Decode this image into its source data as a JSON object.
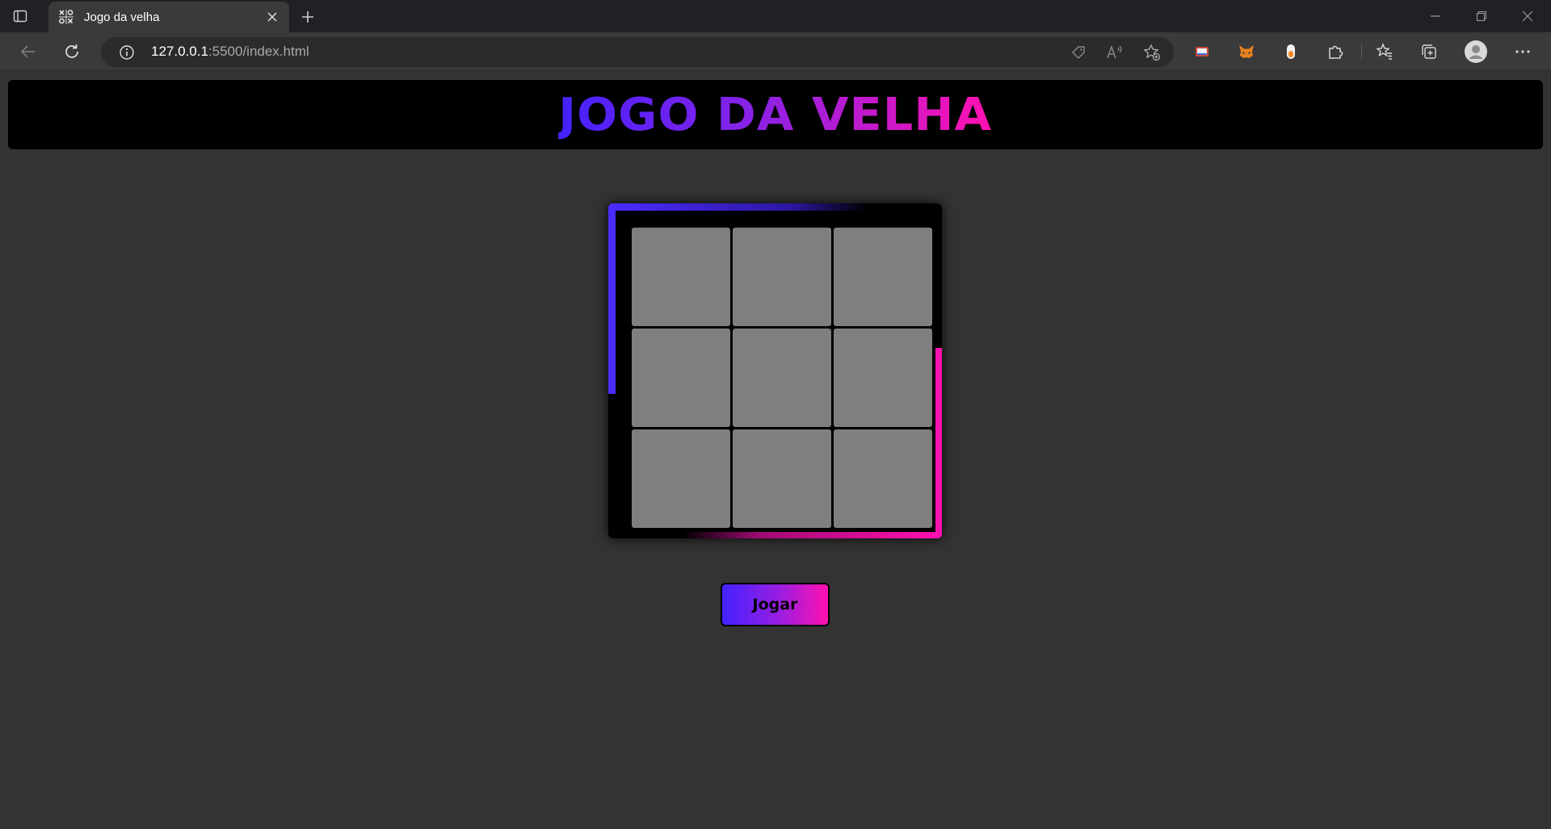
{
  "browser": {
    "tab": {
      "title": "Jogo da velha",
      "favicon": "tic-tac-toe-favicon"
    },
    "address": {
      "host": "127.0.0.1",
      "rest": ":5500/index.html"
    },
    "colors": {
      "tabstrip": "#202124",
      "toolbar": "#3a3a3a",
      "omnibox": "#2b2b2b"
    }
  },
  "page": {
    "title": "JOGO DA VELHA",
    "board": {
      "rows": 3,
      "cols": 3,
      "cells": [
        "",
        "",
        "",
        "",
        "",
        "",
        "",
        "",
        ""
      ]
    },
    "play_button": "Jogar",
    "colors": {
      "background": "#333333",
      "gradient_start": "#4422ff",
      "gradient_end": "#ff11b0",
      "cell": "#7f7f7f"
    }
  }
}
